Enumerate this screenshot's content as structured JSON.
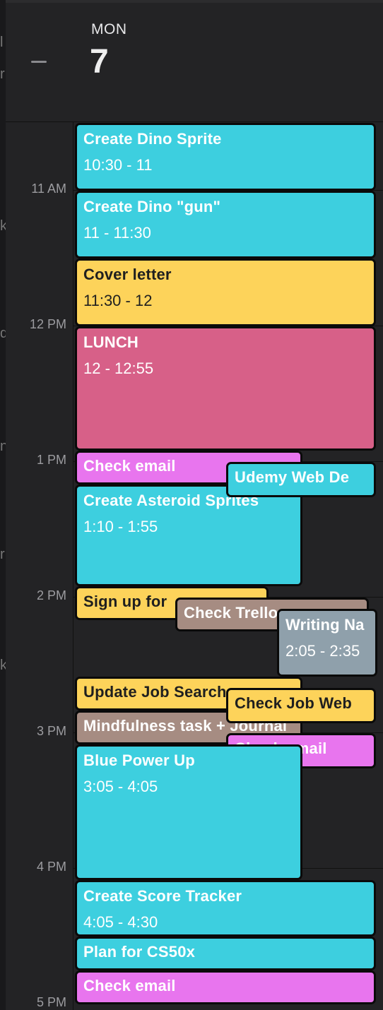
{
  "header": {
    "day_of_week": "MON",
    "day_number": "7"
  },
  "left_strip": {
    "fragments": [
      "l",
      "r",
      "k",
      "d",
      "n",
      "r",
      "k"
    ]
  },
  "time_labels": [
    "11 AM",
    "12 PM",
    "1 PM",
    "2 PM",
    "3 PM",
    "4 PM",
    "5 PM"
  ],
  "colors": {
    "cyan": "#3dcfdf",
    "yellow": "#fdd35a",
    "pink": "#d76088",
    "magenta": "#e875ee",
    "taupe": "#a68c82",
    "slate": "#8fa0ab"
  },
  "events": [
    {
      "title": "Create Dino Sprite",
      "time": "10:30 - 11",
      "color": "cyan"
    },
    {
      "title": "Create Dino \"gun\"",
      "time": "11 - 11:30",
      "color": "cyan"
    },
    {
      "title": "Cover letter",
      "time": "11:30 - 12",
      "color": "yellow"
    },
    {
      "title": "LUNCH",
      "time": "12 - 12:55",
      "color": "pink"
    },
    {
      "title": "Check email",
      "time": "",
      "color": "magenta"
    },
    {
      "title": "Udemy Web De",
      "time": "",
      "color": "cyan"
    },
    {
      "title": "Create Asteroid Sprites",
      "time": "1:10 - 1:55",
      "color": "cyan"
    },
    {
      "title": "Sign up for",
      "time": "",
      "color": "yellow"
    },
    {
      "title": "Check Trello",
      "time": "",
      "color": "taupe"
    },
    {
      "title": "Writing Na",
      "time": "2:05 - 2:35",
      "color": "slate"
    },
    {
      "title": "Update Job Search",
      "time": "",
      "color": "yellow"
    },
    {
      "title": "Check Job Web",
      "time": "",
      "color": "yellow"
    },
    {
      "title": "Mindfulness task + Journal",
      "time": "",
      "color": "taupe"
    },
    {
      "title": "Check email",
      "time": "",
      "color": "magenta"
    },
    {
      "title": "Blue Power Up",
      "time": "3:05 - 4:05",
      "color": "cyan"
    },
    {
      "title": "Create Score Tracker",
      "time": "4:05 - 4:30",
      "color": "cyan"
    },
    {
      "title": "Plan for CS50x",
      "time": "",
      "color": "cyan"
    },
    {
      "title": "Check email",
      "time": "",
      "color": "magenta"
    }
  ]
}
